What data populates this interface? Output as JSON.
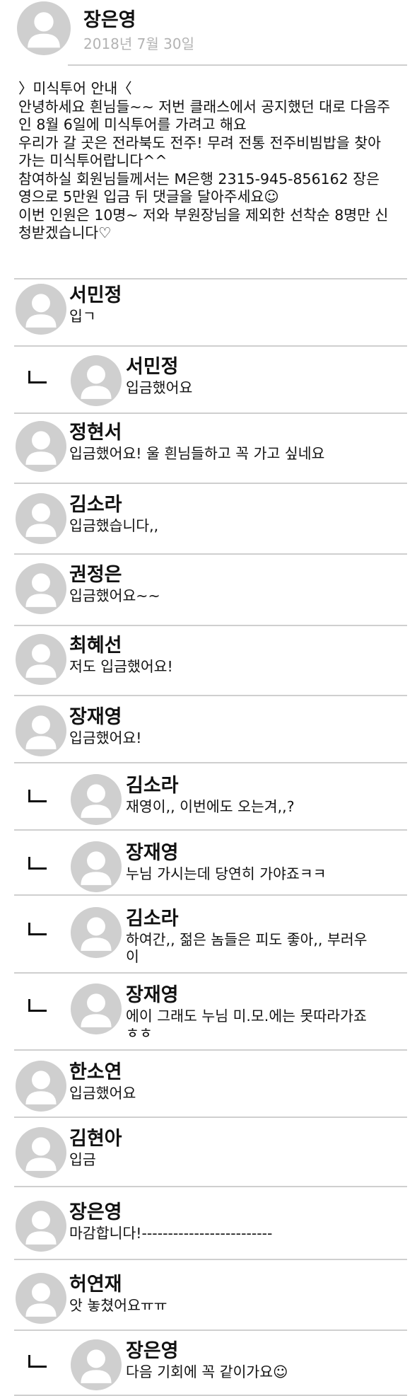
{
  "post": {
    "author": "장은영",
    "date": "2018년 7월 30일",
    "body_lines": [
      "〉미식투어 안내〈",
      "안녕하세요 흰님들~~ 저번 클래스에서 공지했던 대로 다음주",
      "인 8월 6일에 미식투어를 가려고 해요",
      "우리가 갈 곳은 전라북도 전주! 무려 전통 전주비빔밥을 찾아",
      "가는 미식투어랍니다^^",
      "참여하실 회원님들께서는 M은행 2315-945-856162 장은",
      "영으로 5만원 입금 뒤 댓글을 달아주세요☺",
      "이번 인원은 10명~ 저와 부원장님을 제외한 선착순 8명만 신",
      "청받겠습니다♡"
    ]
  },
  "comments": [
    {
      "name": "서민정",
      "lines": [
        "입ㄱ"
      ],
      "reply": false
    },
    {
      "name": "서민정",
      "lines": [
        "입금했어요"
      ],
      "reply": true
    },
    {
      "name": "정현서",
      "lines": [
        "입금했어요! 울 흰님들하고 꼭 가고 싶네요"
      ],
      "reply": false
    },
    {
      "name": "김소라",
      "lines": [
        "입금했습니다,,"
      ],
      "reply": false
    },
    {
      "name": "권정은",
      "lines": [
        "입금했어요~~"
      ],
      "reply": false
    },
    {
      "name": "최혜선",
      "lines": [
        "저도 입금했어요!"
      ],
      "reply": false
    },
    {
      "name": "장재영",
      "lines": [
        "입금했어요!"
      ],
      "reply": false
    },
    {
      "name": "김소라",
      "lines": [
        "재영이,, 이번에도 오는겨,,?"
      ],
      "reply": true
    },
    {
      "name": "장재영",
      "lines": [
        "누님 가시는데 당연히 가야죠ㅋㅋ"
      ],
      "reply": true
    },
    {
      "name": "김소라",
      "lines": [
        "하여간,, 젊은 놈들은 피도 좋아,, 부러우",
        "이"
      ],
      "reply": true
    },
    {
      "name": "장재영",
      "lines": [
        "에이 그래도 누님 미.모.에는 못따라가죠",
        "ㅎㅎ"
      ],
      "reply": true
    },
    {
      "name": "한소연",
      "lines": [
        "입금했어요"
      ],
      "reply": false
    },
    {
      "name": "김현아",
      "lines": [
        "입금"
      ],
      "reply": false
    },
    {
      "name": "장은영",
      "lines": [
        "마감합니다!-------------------------"
      ],
      "reply": false
    },
    {
      "name": "허연재",
      "lines": [
        "앗 놓쳤어요ㅠㅠ"
      ],
      "reply": false
    },
    {
      "name": "장은영",
      "lines": [
        "다음 기회에 꼭 같이가요☺"
      ],
      "reply": true
    }
  ],
  "icons": {
    "avatar": "default-user-avatar-icon",
    "reply": "reply-corner-icon"
  },
  "colors": {
    "avatar_bg": "#cfcfcf",
    "avatar_figure": "#ffffff",
    "divider": "#cfcfcf",
    "date": "#b3b3b3",
    "text": "#111111"
  }
}
